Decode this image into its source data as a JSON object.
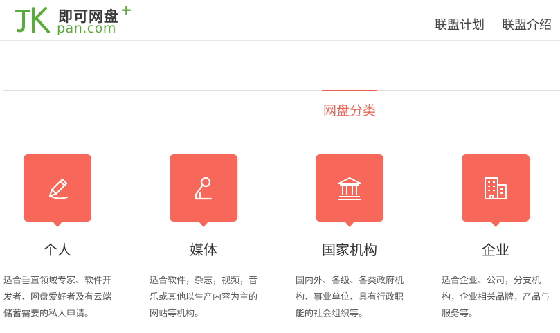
{
  "header": {
    "logo_cn": "即可网盘",
    "logo_en": "pan.com",
    "logo_plus": "+",
    "nav": [
      "联盟计划",
      "联盟介绍"
    ]
  },
  "section": {
    "active_tab": "网盘分类"
  },
  "categories": [
    {
      "title": "个人",
      "icon": "pen-icon",
      "desc": "适合垂直领域专家、软件开发者、网盘爱好者及有云端储蓄需要的私人申请。"
    },
    {
      "title": "媒体",
      "icon": "microphone-icon",
      "desc": "适合软件，杂志，视频，音乐或其他以生产内容为主的网站等机构。"
    },
    {
      "title": "国家机构",
      "icon": "government-building-icon",
      "desc": "国内外、各级、各类政府机构、事业单位、具有行政职能的社会组织等。"
    },
    {
      "title": "企业",
      "icon": "office-building-icon",
      "desc": "适合企业、公司，分支机构，企业相关品牌，产品与服务等。"
    }
  ],
  "colors": {
    "accent": "#f06454",
    "icon_bg": "#f8685a",
    "logo_green": "#5aab3a"
  }
}
